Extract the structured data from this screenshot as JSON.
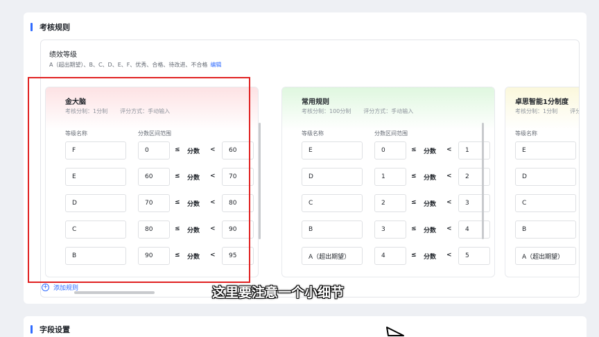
{
  "section1": {
    "title": "考核规则"
  },
  "section2": {
    "title": "字段设置"
  },
  "levels_card": {
    "title": "绩效等级",
    "levels_text": "A（超出期望）、B、C、D、E、F、优秀、合格、待改进、不合格",
    "edit_label": "编辑"
  },
  "labels": {
    "col_level": "等级名称",
    "col_range": "分数区间范围",
    "le": "≤",
    "lt": "<",
    "score": "分数"
  },
  "rules": [
    {
      "name": "金大脑",
      "score_system": "考核分制：1分制",
      "input_mode": "评分方式：手动输入",
      "rows": [
        {
          "level": "F",
          "min": "0",
          "max": "60"
        },
        {
          "level": "E",
          "min": "60",
          "max": "70"
        },
        {
          "level": "D",
          "min": "70",
          "max": "80"
        },
        {
          "level": "C",
          "min": "80",
          "max": "90"
        },
        {
          "level": "B",
          "min": "90",
          "max": "95"
        }
      ]
    },
    {
      "name": "常用规则",
      "score_system": "考核分制：100分制",
      "input_mode": "评分方式：手动输入",
      "rows": [
        {
          "level": "E",
          "min": "0",
          "max": "1"
        },
        {
          "level": "D",
          "min": "1",
          "max": "2"
        },
        {
          "level": "C",
          "min": "2",
          "max": "3"
        },
        {
          "level": "B",
          "min": "3",
          "max": "4"
        },
        {
          "level": "A（超出期望）",
          "min": "4",
          "max": "5"
        }
      ]
    },
    {
      "name": "卓思智能1分制度",
      "score_system": "考核分制：1分制",
      "input_mode": "评分",
      "rows": [
        {
          "level": "E"
        },
        {
          "level": "D"
        },
        {
          "level": "C"
        },
        {
          "level": "B"
        },
        {
          "level": "A（超出期望）"
        }
      ]
    }
  ],
  "add_rule_label": "添加规则",
  "subtitle": "这里要注意一个小细节",
  "colors": {
    "accent": "#2f6bff",
    "highlight": "#e02020"
  }
}
